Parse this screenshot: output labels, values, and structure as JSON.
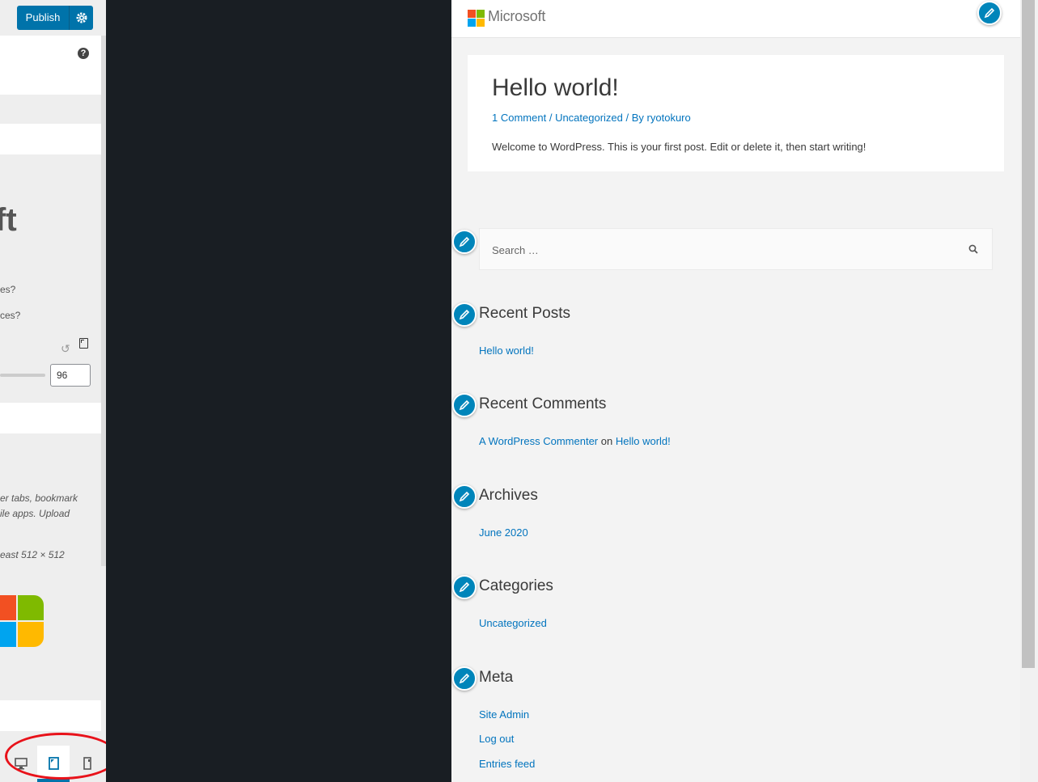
{
  "customizer": {
    "publish_label": "Publish",
    "fragments": {
      "big_letter": "ft",
      "q1": "es?",
      "q2": "ces?",
      "desc1": "er tabs, bookmark",
      "desc2": "ile apps. Upload",
      "desc3": "east 512 × 512"
    },
    "number_value": "96"
  },
  "preview": {
    "brand": "Microsoft",
    "post": {
      "title": "Hello world!",
      "meta_comments": "1 Comment",
      "meta_category": "Uncategorized",
      "meta_by": "By",
      "meta_author": "ryotokuro",
      "excerpt": "Welcome to WordPress. This is your first post. Edit or delete it, then start writing!"
    },
    "search_placeholder": "Search …",
    "widgets": {
      "recent_posts": {
        "title": "Recent Posts",
        "items": [
          "Hello world!"
        ]
      },
      "recent_comments": {
        "title": "Recent Comments",
        "author": "A WordPress Commenter",
        "on": "on",
        "post": "Hello world!"
      },
      "archives": {
        "title": "Archives",
        "items": [
          "June 2020"
        ]
      },
      "categories": {
        "title": "Categories",
        "items": [
          "Uncategorized"
        ]
      },
      "meta": {
        "title": "Meta",
        "items": [
          "Site Admin",
          "Log out",
          "Entries feed"
        ]
      }
    }
  },
  "colors": {
    "accent": "#0073aa",
    "link": "#0274be",
    "annotation": "#e8121a",
    "ms_red": "#f25022",
    "ms_green": "#7fba00",
    "ms_blue": "#00a4ef",
    "ms_yellow": "#ffb900"
  }
}
